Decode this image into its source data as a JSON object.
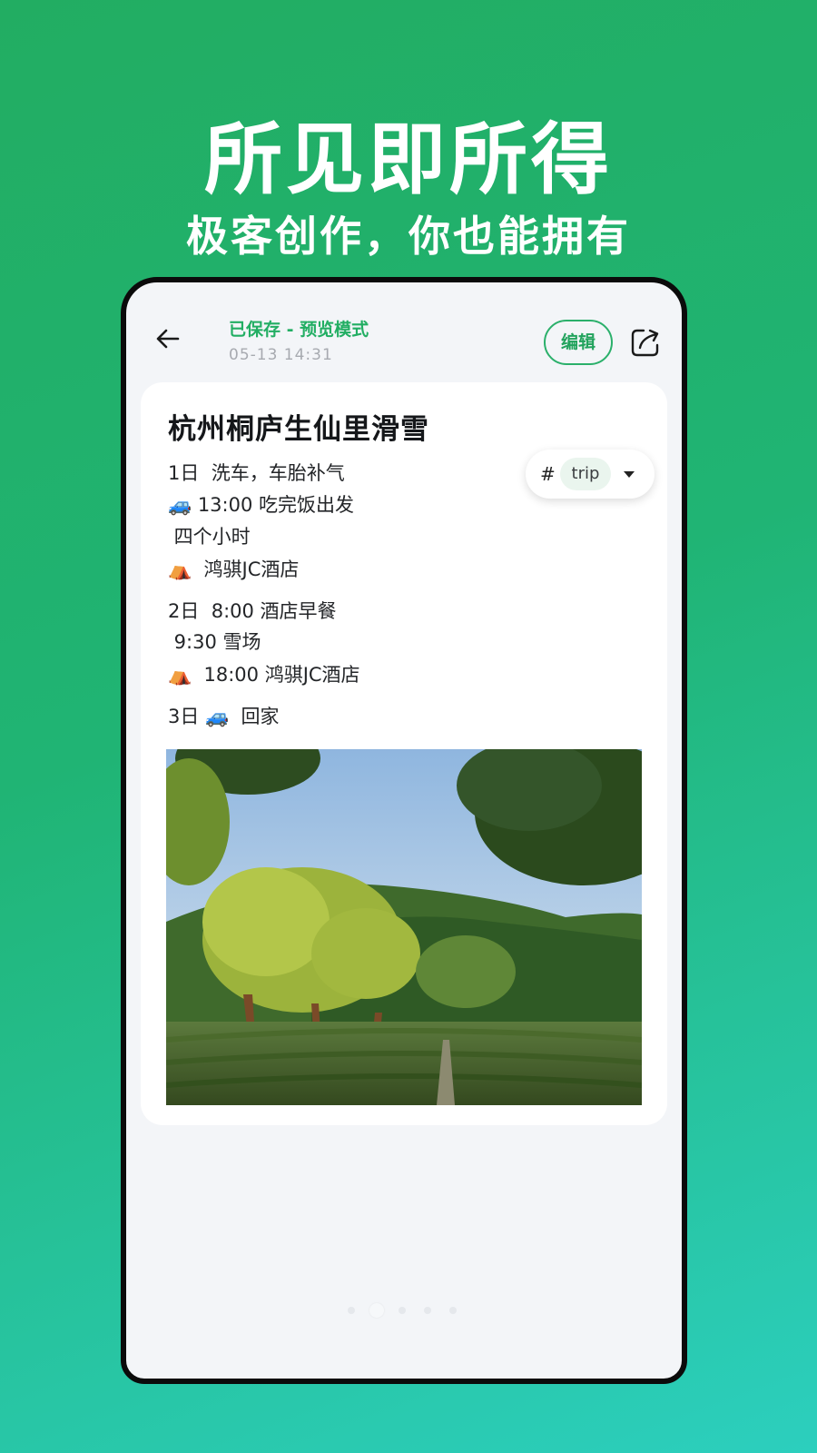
{
  "promo": {
    "title": "所见即所得",
    "subtitle": "极客创作，你也能拥有"
  },
  "header": {
    "status": "已保存 - 预览模式",
    "timestamp": "05-13 14:31",
    "edit_label": "编辑",
    "back_icon": "arrow-left-icon",
    "share_icon": "share-icon"
  },
  "note": {
    "title": "杭州桐庐生仙里滑雪",
    "lines": [
      "1日  洗车，车胎补气",
      "🚙 13:00 吃完饭出发",
      " 四个小时",
      "⛺  鸿骐JC酒店",
      "2日  8:00 酒店早餐",
      " 9:30 雪场",
      "⛺  18:00 鸿骐JC酒店",
      "3日 🚙  回家"
    ],
    "tag": {
      "hash": "#",
      "name": "trip"
    }
  },
  "pager": {
    "count": 5,
    "active_index": 1
  },
  "colors": {
    "accent": "#22ae63",
    "background_top": "#22ad62",
    "background_bottom": "#2ccfbe"
  }
}
